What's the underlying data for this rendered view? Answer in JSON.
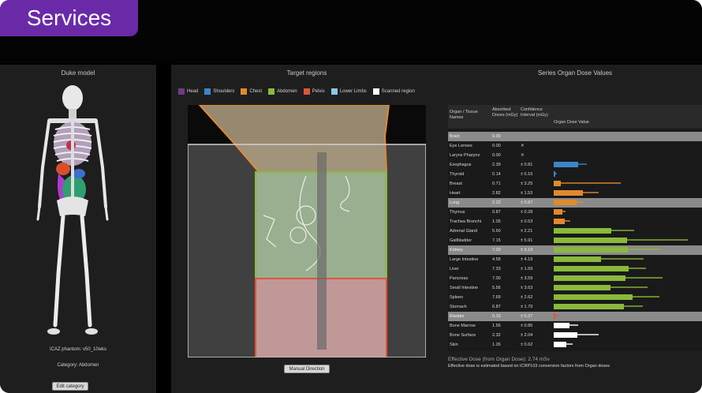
{
  "tag": "Services",
  "left_panel": {
    "title": "Duke model",
    "phantom_label": "ICAZ phantom: v50_10wks",
    "category_label": "Category: Abdomen",
    "edit_button": "Edit category"
  },
  "middle_panel": {
    "title": "Target regions",
    "legend": [
      {
        "label": "Head",
        "color": "#6f3a86"
      },
      {
        "label": "Shoulders",
        "color": "#3a86c8"
      },
      {
        "label": "Chest",
        "color": "#e08a2e"
      },
      {
        "label": "Abdomen",
        "color": "#8ab93c"
      },
      {
        "label": "Pelvis",
        "color": "#e0553a"
      },
      {
        "label": "Lower Limbs",
        "color": "#8ec6e8"
      },
      {
        "label": "Scanned region",
        "color": "#ffffff"
      }
    ],
    "manual_button": "Manual Direction"
  },
  "right_panel": {
    "title": "Series Organ Dose Values",
    "headers": {
      "organ": "Organ / Tissue Names",
      "dose": "Absorbed Doses (mGy)",
      "ci": "Confidence Interval (mGy)",
      "value": "Organ Dose Value"
    },
    "rows": [
      {
        "name": "Brain",
        "dose": "0.00",
        "ci": "",
        "hl": true,
        "color": "",
        "bar": 0,
        "errw": 0
      },
      {
        "name": "Eye Lenses",
        "dose": "0.00",
        "ci": "✕",
        "hl": false,
        "color": "",
        "bar": 0,
        "errw": 0
      },
      {
        "name": "Larynx Pharynx",
        "dose": "0.00",
        "ci": "✕",
        "hl": false,
        "color": "",
        "bar": 0,
        "errw": 0
      },
      {
        "name": "Esophagus",
        "dose": "2.39",
        "ci": "± 0.81",
        "hl": false,
        "color": "#3a86c8",
        "bar": 2.39,
        "errw": 0.81
      },
      {
        "name": "Thyroid",
        "dose": "0.14",
        "ci": "± 0.16",
        "hl": false,
        "color": "#3a86c8",
        "bar": 0.14,
        "errw": 0.16
      },
      {
        "name": "Breast",
        "dose": "0.71",
        "ci": "± 3.25",
        "hl": false,
        "color": "#e08a2e",
        "bar": 0.71,
        "errw": 3.25
      },
      {
        "name": "Heart",
        "dose": "2.82",
        "ci": "± 1.53",
        "hl": false,
        "color": "#e08a2e",
        "bar": 2.82,
        "errw": 1.53
      },
      {
        "name": "Lung",
        "dose": "2.23",
        "ci": "± 0.67",
        "hl": true,
        "color": "#e08a2e",
        "bar": 2.23,
        "errw": 0.67
      },
      {
        "name": "Thymus",
        "dose": "0.87",
        "ci": "± 0.28",
        "hl": false,
        "color": "#e08a2e",
        "bar": 0.87,
        "errw": 0.28
      },
      {
        "name": "Trachea Bronchi",
        "dose": "1.05",
        "ci": "± 0.53",
        "hl": false,
        "color": "#e08a2e",
        "bar": 1.05,
        "errw": 0.53
      },
      {
        "name": "Adrenal Gland",
        "dose": "5.60",
        "ci": "± 2.21",
        "hl": false,
        "color": "#8ab93c",
        "bar": 5.6,
        "errw": 2.21
      },
      {
        "name": "Gallbladder",
        "dose": "7.15",
        "ci": "± 5.91",
        "hl": false,
        "color": "#8ab93c",
        "bar": 7.15,
        "errw": 5.91
      },
      {
        "name": "Kidney",
        "dose": "7.20",
        "ci": "± 3.19",
        "hl": true,
        "color": "#8ab93c",
        "bar": 7.2,
        "errw": 3.19
      },
      {
        "name": "Large Intestine",
        "dose": "4.58",
        "ci": "± 4.19",
        "hl": false,
        "color": "#8ab93c",
        "bar": 4.58,
        "errw": 4.19
      },
      {
        "name": "Liver",
        "dose": "7.33",
        "ci": "± 1.69",
        "hl": false,
        "color": "#8ab93c",
        "bar": 7.33,
        "errw": 1.69
      },
      {
        "name": "Pancreas",
        "dose": "7.00",
        "ci": "± 3.59",
        "hl": false,
        "color": "#8ab93c",
        "bar": 7.0,
        "errw": 3.59
      },
      {
        "name": "Small Intestine",
        "dose": "5.56",
        "ci": "± 3.63",
        "hl": false,
        "color": "#8ab93c",
        "bar": 5.56,
        "errw": 3.63
      },
      {
        "name": "Spleen",
        "dose": "7.69",
        "ci": "± 2.62",
        "hl": false,
        "color": "#8ab93c",
        "bar": 7.69,
        "errw": 2.62
      },
      {
        "name": "Stomach",
        "dose": "6.87",
        "ci": "± 1.79",
        "hl": false,
        "color": "#8ab93c",
        "bar": 6.87,
        "errw": 1.79
      },
      {
        "name": "Bladder",
        "dose": "0.10",
        "ci": "± 0.27",
        "hl": true,
        "color": "#e0553a",
        "bar": 0.1,
        "errw": 0.27
      },
      {
        "name": "Bone Marrow",
        "dose": "1.56",
        "ci": "± 0.85",
        "hl": false,
        "color": "#ffffff",
        "bar": 1.56,
        "errw": 0.85
      },
      {
        "name": "Bone Surface",
        "dose": "2.32",
        "ci": "± 2.04",
        "hl": false,
        "color": "#ffffff",
        "bar": 2.32,
        "errw": 2.04
      },
      {
        "name": "Skin",
        "dose": "1.26",
        "ci": "± 0.62",
        "hl": false,
        "color": "#ffffff",
        "bar": 1.26,
        "errw": 0.62
      }
    ],
    "effective_dose": "Effective Dose (from Organ Dose): 2.74 mSv",
    "effective_note": "Effective dose is estimated based on ICRP103 conversion factors from Organ doses"
  }
}
